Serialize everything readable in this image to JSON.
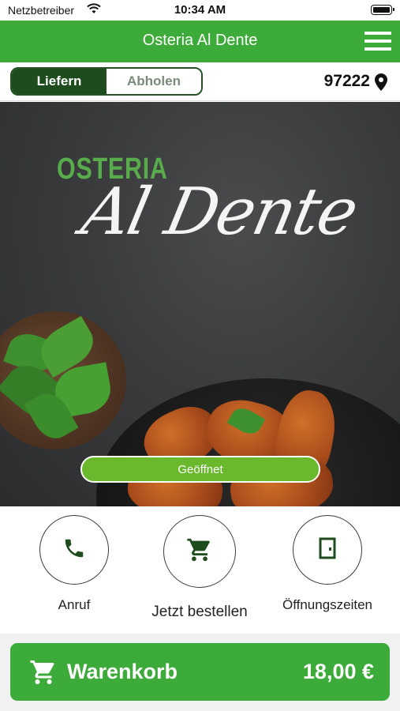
{
  "status_bar": {
    "carrier": "Netzbetreiber",
    "time": "10:34 AM"
  },
  "header": {
    "title": "Osteria Al Dente",
    "menu_icon": "hamburger-menu-icon"
  },
  "order_mode": {
    "options": [
      "Liefern",
      "Abholen"
    ],
    "selected": "Liefern",
    "zip": "97222",
    "location_icon": "map-pin-icon"
  },
  "hero": {
    "logo_line1": "OSTERIA",
    "logo_line2": "Al Dente",
    "status": "Geöffnet"
  },
  "actions": [
    {
      "label": "Anruf",
      "icon": "phone-icon"
    },
    {
      "label": "Jetzt bestellen",
      "icon": "cart-icon"
    },
    {
      "label": "Öffnungszeiten",
      "icon": "door-icon"
    }
  ],
  "cart": {
    "label": "Warenkorb",
    "total": "18,00 €",
    "icon": "cart-icon"
  },
  "colors": {
    "brand_green": "#3cab3a",
    "dark_green": "#1e4c1e",
    "status_green": "#6ab82c"
  }
}
